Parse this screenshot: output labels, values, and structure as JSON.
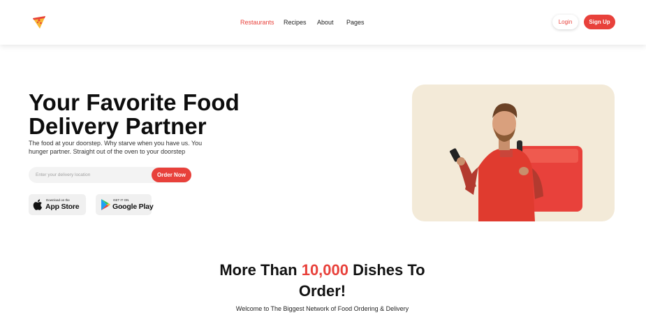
{
  "nav": {
    "items": [
      {
        "label": "Restaurants",
        "active": true
      },
      {
        "label": "Recipes",
        "active": false
      },
      {
        "label": "About",
        "active": false
      },
      {
        "label": "Pages",
        "active": false
      }
    ],
    "login_label": "Login",
    "signup_label": "Sign Up"
  },
  "hero": {
    "title_line1": "Your Favorite Food",
    "title_line2": "Delivery Partner",
    "subtitle": "The food at your doorstep. Why starve when you have us. You hunger partner. Straight out of the oven to your doorstep",
    "search": {
      "placeholder": "Enter your delivery location",
      "button_label": "Order Now"
    },
    "stores": {
      "apple_small": "Download on the",
      "apple_big": "App Store",
      "google_small": "GET IT ON",
      "google_big": "Google Play"
    }
  },
  "section": {
    "title_pre": "More Than ",
    "title_accent": "10,000",
    "title_post": " Dishes To Order!",
    "subtitle": "Welcome to The Biggest Network of Food Ordering & Delivery"
  },
  "colors": {
    "accent": "#e8413b",
    "card_bg": "#f3ead8",
    "input_bg": "#f3f3f3"
  },
  "icons": [
    "pizza-logo-icon",
    "apple-icon",
    "google-play-icon"
  ]
}
